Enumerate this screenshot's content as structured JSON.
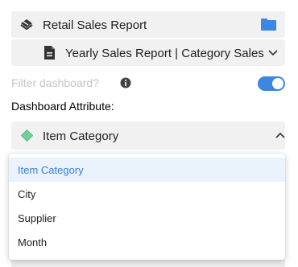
{
  "report": {
    "label": "Retail Sales Report",
    "icon": "report-stack-icon",
    "action_icon": "folder-icon"
  },
  "dashboard": {
    "label": "Yearly Sales Report | Category Sales",
    "icon": "document-icon",
    "chevron": "chevron-down-icon"
  },
  "filter": {
    "label": "Filter dashboard?",
    "info_icon": "info-icon",
    "enabled": true
  },
  "attribute": {
    "heading": "Dashboard Attribute:",
    "selected_label": "Item Category",
    "icon": "diamond-icon",
    "chevron": "chevron-up-icon"
  },
  "menu": {
    "options": [
      {
        "label": "Item Category",
        "selected": true
      },
      {
        "label": "City",
        "selected": false
      },
      {
        "label": "Supplier",
        "selected": false
      },
      {
        "label": "Month",
        "selected": false
      }
    ]
  },
  "colors": {
    "accent": "#3d86e3",
    "selected_text": "#3b7fd6",
    "selected_bg": "#eaf2fc",
    "diamond": "#6fcf97",
    "row_bg": "#f1f1f1"
  }
}
